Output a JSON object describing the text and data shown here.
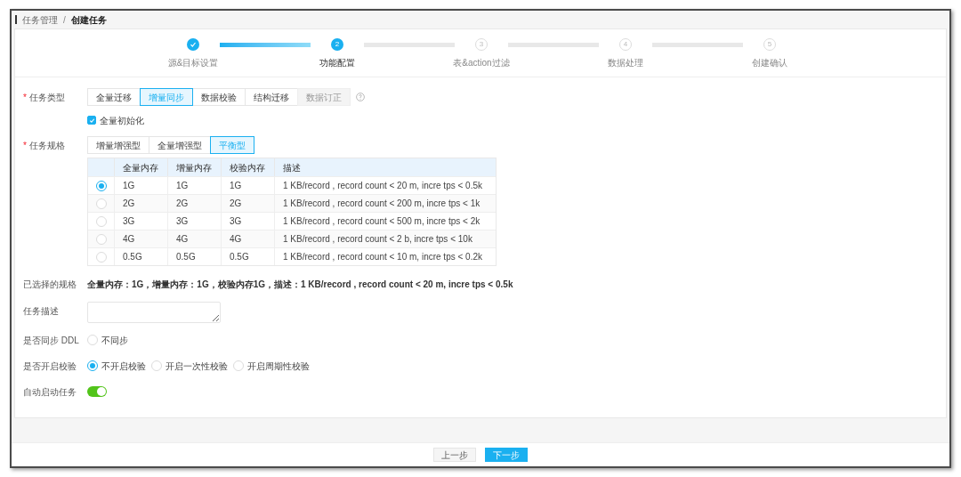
{
  "breadcrumb": [
    {
      "label": "任务管理",
      "current": false
    },
    {
      "label": "创建任务",
      "current": true
    }
  ],
  "breadcrumb_separator": "/",
  "steps": [
    {
      "label": "源&目标设置",
      "done": true,
      "active": false
    },
    {
      "number": "2",
      "label": "功能配置",
      "done": false,
      "active": true
    },
    {
      "number": "3",
      "label": "表&action过滤",
      "done": false,
      "active": false
    },
    {
      "number": "4",
      "label": "数据处理",
      "done": false,
      "active": false
    },
    {
      "number": "5",
      "label": "创建确认",
      "done": false,
      "active": false
    }
  ],
  "task_type": {
    "label": "任务类型",
    "required_mark": "*",
    "options": [
      {
        "label": "全量迁移",
        "selected": false,
        "disabled": false
      },
      {
        "label": "增量同步",
        "selected": true,
        "disabled": false
      },
      {
        "label": "数据校验",
        "selected": false,
        "disabled": false
      },
      {
        "label": "结构迁移",
        "selected": false,
        "disabled": false
      },
      {
        "label": "数据订正",
        "selected": false,
        "disabled": true
      }
    ]
  },
  "full_init": {
    "label": "全量初始化",
    "checked": true
  },
  "task_spec": {
    "label": "任务规格",
    "required_mark": "*",
    "options": [
      {
        "label": "增量增强型",
        "selected": false
      },
      {
        "label": "全量增强型",
        "selected": false
      },
      {
        "label": "平衡型",
        "selected": true
      }
    ]
  },
  "spec_table": {
    "columns": [
      "全量内存",
      "增量内存",
      "校验内存",
      "描述"
    ],
    "rows": [
      {
        "selected": true,
        "cells": [
          "1G",
          "1G",
          "1G",
          "1 KB/record , record count < 20 m, incre tps < 0.5k"
        ]
      },
      {
        "selected": false,
        "cells": [
          "2G",
          "2G",
          "2G",
          "1 KB/record , record count < 200 m, incre tps < 1k"
        ]
      },
      {
        "selected": false,
        "cells": [
          "3G",
          "3G",
          "3G",
          "1 KB/record , record count < 500 m, incre tps < 2k"
        ]
      },
      {
        "selected": false,
        "cells": [
          "4G",
          "4G",
          "4G",
          "1 KB/record , record count < 2 b, incre tps < 10k"
        ]
      },
      {
        "selected": false,
        "cells": [
          "0.5G",
          "0.5G",
          "0.5G",
          "1 KB/record , record count < 10 m, incre tps < 0.2k"
        ]
      }
    ]
  },
  "selected_spec": {
    "label": "已选择的规格",
    "value": "全量内存：1G，增量内存：1G，校验内存1G，描述：1 KB/record , record count < 20 m, incre tps < 0.5k"
  },
  "task_description": {
    "label": "任务描述"
  },
  "sync_ddl": {
    "label": "是否同步 DDL",
    "options": [
      {
        "label": "不同步",
        "selected": false
      }
    ]
  },
  "enable_check": {
    "label": "是否开启校验",
    "options": [
      {
        "label": "不开启校验",
        "selected": true
      },
      {
        "label": "开启一次性校验",
        "selected": false
      },
      {
        "label": "开启周期性校验",
        "selected": false
      }
    ]
  },
  "auto_start": {
    "label": "自动启动任务",
    "on": true
  },
  "footer_buttons": [
    {
      "label": "上一步",
      "kind": "secondary"
    },
    {
      "label": "下一步",
      "kind": "primary"
    }
  ]
}
